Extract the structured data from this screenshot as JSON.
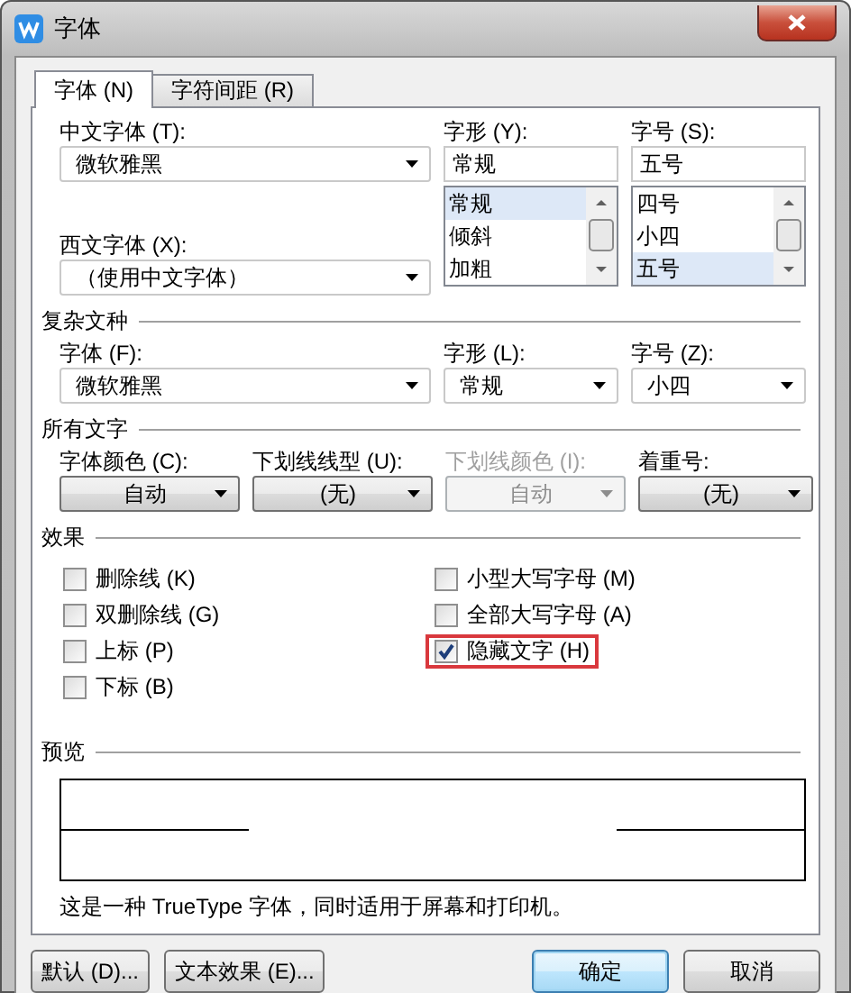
{
  "window": {
    "title": "字体"
  },
  "tabs": [
    {
      "label": "字体 (N)",
      "selected": true
    },
    {
      "label": "字符间距 (R)",
      "selected": false
    }
  ],
  "latin": {
    "chinese_font": {
      "label": "中文字体 (T):",
      "value": "微软雅黑"
    },
    "western_font": {
      "label": "西文字体 (X):",
      "value": "（使用中文字体）"
    },
    "style": {
      "label": "字形 (Y):",
      "value": "常规",
      "items": [
        {
          "label": "常规",
          "selected": true
        },
        {
          "label": "倾斜",
          "selected": false
        },
        {
          "label": "加粗",
          "selected": false
        }
      ]
    },
    "size": {
      "label": "字号 (S):",
      "value": "五号",
      "items": [
        {
          "label": "四号",
          "selected": false
        },
        {
          "label": "小四",
          "selected": false
        },
        {
          "label": "五号",
          "selected": true
        }
      ]
    }
  },
  "complex": {
    "title": "复杂文种",
    "fields": [
      {
        "label": "字体 (F):",
        "value": "微软雅黑"
      },
      {
        "label": "字形 (L):",
        "value": "常规"
      },
      {
        "label": "字号 (Z):",
        "value": "小四"
      }
    ]
  },
  "all_text": {
    "title": "所有文字",
    "fields": [
      {
        "label": "字体颜色 (C):",
        "value": "自动",
        "disabled": false
      },
      {
        "label": "下划线线型 (U):",
        "value": "(无)",
        "disabled": false
      },
      {
        "label": "下划线颜色 (I):",
        "value": "自动",
        "disabled": true
      },
      {
        "label": "着重号:",
        "value": "(无)",
        "disabled": false
      }
    ]
  },
  "effects": {
    "title": "效果",
    "columns": [
      [
        {
          "label": "删除线 (K)",
          "checked": false,
          "highlighted": false
        },
        {
          "label": "双删除线 (G)",
          "checked": false,
          "highlighted": false
        },
        {
          "label": "上标 (P)",
          "checked": false,
          "highlighted": false
        },
        {
          "label": "下标 (B)",
          "checked": false,
          "highlighted": false
        }
      ],
      [
        {
          "label": "小型大写字母 (M)",
          "checked": false,
          "highlighted": false
        },
        {
          "label": "全部大写字母 (A)",
          "checked": false,
          "highlighted": false
        },
        {
          "label": "隐藏文字 (H)",
          "checked": true,
          "highlighted": true
        }
      ]
    ]
  },
  "preview": {
    "title": "预览",
    "note": "这是一种 TrueType 字体，同时适用于屏幕和打印机。"
  },
  "buttons": [
    {
      "label": "默认 (D)...",
      "kind": "normal"
    },
    {
      "label": "文本效果 (E)...",
      "kind": "normal"
    },
    {
      "label": "确定",
      "kind": "primary"
    },
    {
      "label": "取消",
      "kind": "normal"
    }
  ]
}
